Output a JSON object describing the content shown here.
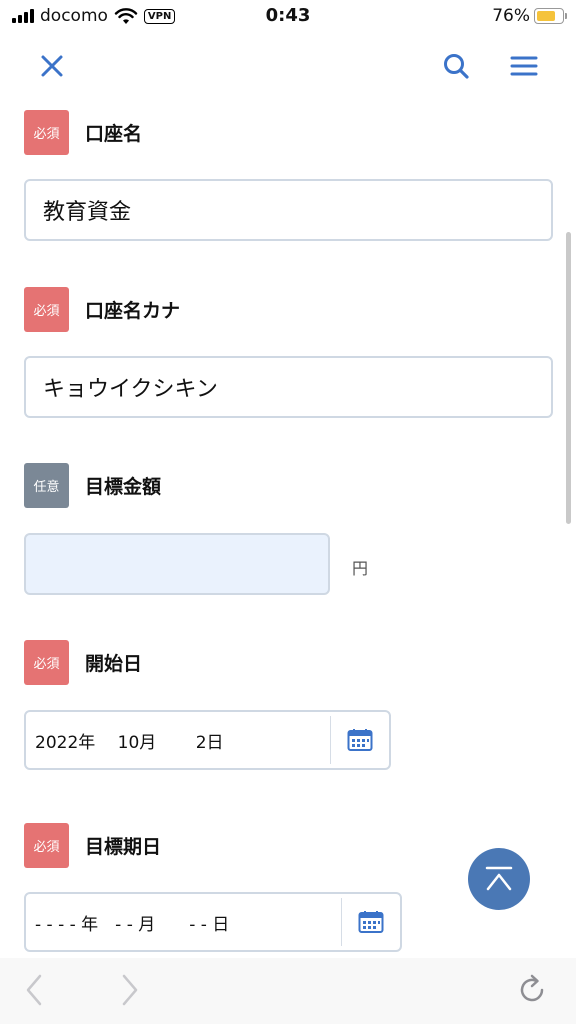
{
  "status_bar": {
    "carrier": "docomo",
    "vpn": "VPN",
    "time": "0:43",
    "battery": "76%",
    "battery_level": 0.76
  },
  "header": {
    "close_icon": "close-icon",
    "search_icon": "search-icon",
    "menu_icon": "hamburger-menu-icon",
    "accent_color": "#3b73c9"
  },
  "form": {
    "account_name": {
      "badge": "必須",
      "label": "口座名",
      "value": "教育資金"
    },
    "account_kana": {
      "badge": "必須",
      "label": "口座名カナ",
      "value": "キョウイクシキン"
    },
    "target_amount": {
      "badge": "任意",
      "label": "目標金額",
      "value": "",
      "unit": "円"
    },
    "start_date": {
      "badge": "必須",
      "label": "開始日",
      "value": "2022年　 10月　　 2日"
    },
    "target_date": {
      "badge": "必須",
      "label": "目標期日",
      "value": "- - - - 年　- - 月　　- - 日"
    }
  },
  "colors": {
    "required_badge": "#e57373",
    "optional_badge": "#7b8896",
    "input_border": "#cfd8e3",
    "amount_bg": "#eaf2fd",
    "scroll_top_button": "#4a78b5"
  },
  "browser_toolbar": {
    "back_icon": "chevron-left-icon",
    "forward_icon": "chevron-right-icon",
    "reload_icon": "reload-icon"
  }
}
